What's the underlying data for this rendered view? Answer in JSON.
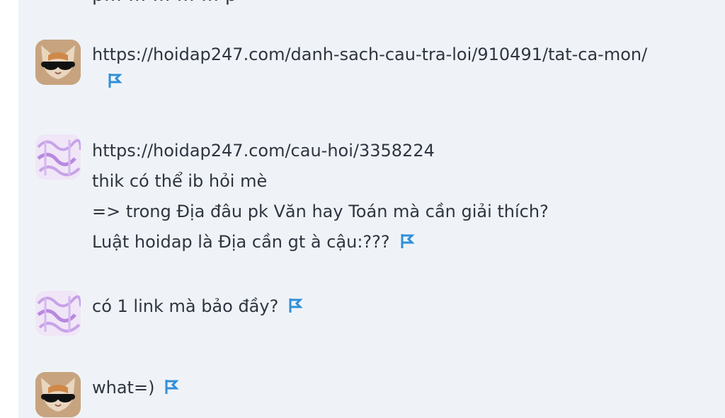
{
  "cutoff_text": "p…   …  …  …  … p",
  "messages": [
    {
      "avatar": "cat-sunglasses-avatar",
      "lines": [
        "https://hoidap247.com/danh-sach-cau-tra-loi/910491/tat-ca-mon/"
      ]
    },
    {
      "avatar": "purple-scribble-avatar",
      "lines": [
        "https://hoidap247.com/cau-hoi/3358224",
        "thik có thể ib hỏi mè",
        "=> trong Địa đâu pk Văn hay Toán mà cần giải thích?",
        "Luật hoidap là Địa cần gt à cậu:???"
      ]
    },
    {
      "avatar": "purple-scribble-avatar",
      "lines": [
        "có 1 link mà bảo đầy?"
      ]
    },
    {
      "avatar": "cat-sunglasses-avatar",
      "lines": [
        "what=)"
      ]
    }
  ],
  "colors": {
    "panel_bg": "#eff3f8",
    "text": "#2f3540",
    "flag": "#2f8fd8"
  },
  "icons": {
    "flag": "flag-report-icon"
  }
}
